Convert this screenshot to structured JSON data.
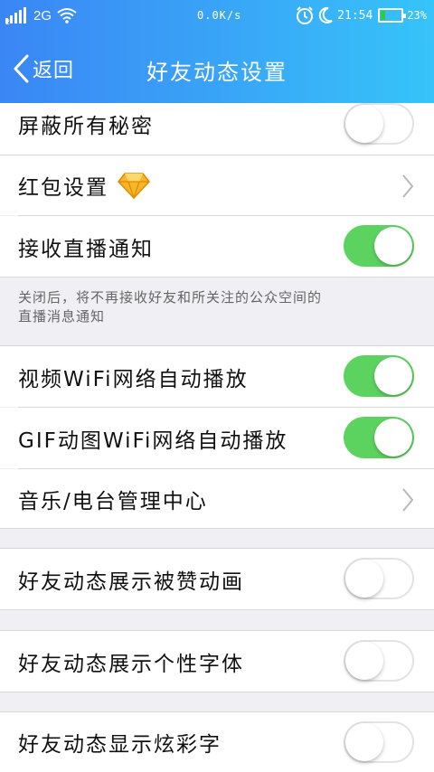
{
  "status_bar": {
    "sim_index": "2",
    "network": "2G",
    "speed": "0.0K/s",
    "time": "21:54",
    "battery_percent": "23%",
    "battery_level": 0.23,
    "icons": [
      "signal-icon",
      "wifi-icon",
      "alarm-icon",
      "moon-icon",
      "battery-icon"
    ]
  },
  "nav": {
    "back_label": "返回",
    "title": "好友动态设置"
  },
  "colors": {
    "header_start": "#3a86f5",
    "header_end": "#36c4f9",
    "toggle_on": "#5dd35f",
    "background": "#efeff4"
  },
  "settings": [
    {
      "label": "屏蔽所有秘密",
      "control": "toggle",
      "state": "off"
    },
    {
      "label": "红包设置",
      "control": "chevron",
      "badge_icon": "diamond-icon"
    },
    {
      "label": "接收直播通知",
      "control": "toggle",
      "state": "on"
    },
    {
      "label": "视频WiFi网络自动播放",
      "control": "toggle",
      "state": "on"
    },
    {
      "label": "GIF动图WiFi网络自动播放",
      "control": "toggle",
      "state": "on"
    },
    {
      "label": "音乐/电台管理中心",
      "control": "chevron"
    },
    {
      "label": "好友动态展示被赞动画",
      "control": "toggle",
      "state": "off"
    },
    {
      "label": "好友动态展示个性字体",
      "control": "toggle",
      "state": "off"
    },
    {
      "label": "好友动态显示炫彩字",
      "control": "toggle",
      "state": "off"
    }
  ],
  "live_note": {
    "line1": "关闭后，将不再接收好友和所关注的公众空间的",
    "line2": "直播消息通知"
  }
}
